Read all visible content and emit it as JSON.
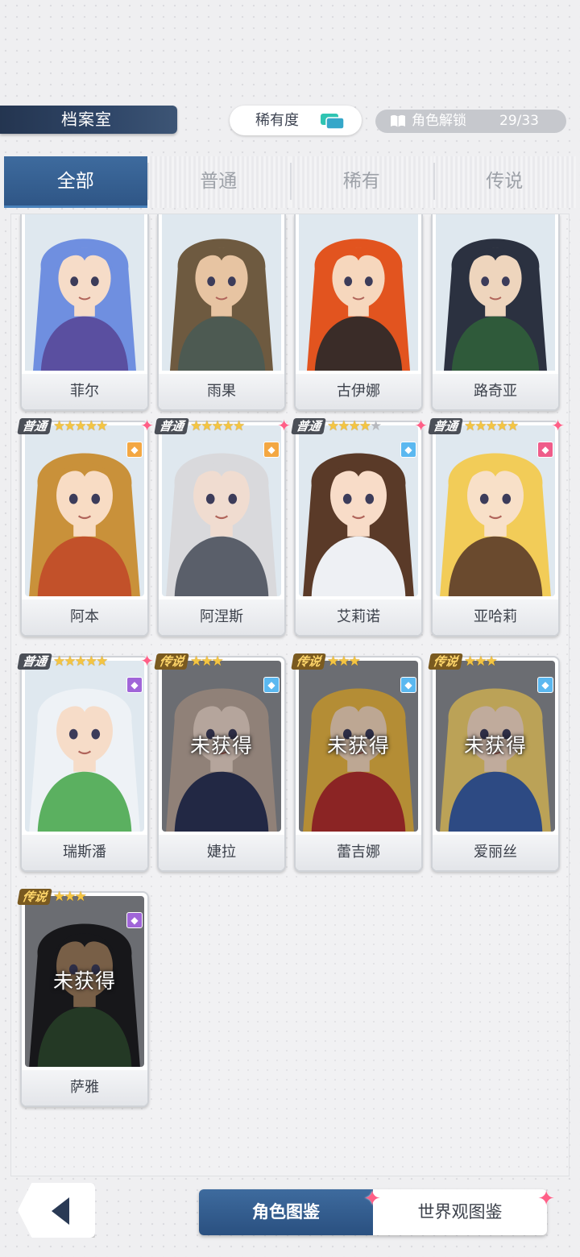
{
  "header": {
    "title": "档案室",
    "rarity_label": "稀有度",
    "unlock_label": "角色解锁",
    "unlock_count": "29/33",
    "unlock_progress": 0.879
  },
  "tabs": [
    {
      "label": "全部",
      "active": true
    },
    {
      "label": "普通",
      "active": false
    },
    {
      "label": "稀有",
      "active": false
    },
    {
      "label": "传说",
      "active": false
    }
  ],
  "locked_text": "未获得",
  "rank_labels": {
    "common": "普通",
    "legend": "传说"
  },
  "characters": [
    {
      "name": "菲尔",
      "hair": "#6f8fe0",
      "outfit": "#5a4fa0",
      "skin": "#f6dcc8"
    },
    {
      "name": "雨果",
      "hair": "#6e5a40",
      "outfit": "#4d5a52",
      "skin": "#e7c4a2"
    },
    {
      "name": "古伊娜",
      "hair": "#e2541f",
      "outfit": "#3a2c28",
      "skin": "#f6d7bd"
    },
    {
      "name": "路奇亚",
      "hair": "#2b3140",
      "outfit": "#2f5a3a",
      "skin": "#eed5bd"
    },
    {
      "name": "阿本",
      "hair": "#c9913a",
      "outfit": "#c2512a",
      "skin": "#f8dcc4",
      "rank": "common",
      "stars": 5,
      "stars_on": 5,
      "element": "orange",
      "spark": true
    },
    {
      "name": "阿涅斯",
      "hair": "#d9d9dc",
      "outfit": "#5a5f6a",
      "skin": "#f0dcd0",
      "rank": "common",
      "stars": 5,
      "stars_on": 5,
      "element": "orange",
      "spark": true
    },
    {
      "name": "艾莉诺",
      "hair": "#5a3a28",
      "outfit": "#eef0f4",
      "skin": "#f8dcc8",
      "rank": "common",
      "stars": 5,
      "stars_on": 4,
      "element": "blue",
      "spark": true
    },
    {
      "name": "亚哈莉",
      "hair": "#f2cc58",
      "outfit": "#6a4a2e",
      "skin": "#f8e0c8",
      "rank": "common",
      "stars": 5,
      "stars_on": 5,
      "element": "pink",
      "spark": true
    },
    {
      "name": "瑞斯潘",
      "hair": "#eef2f6",
      "outfit": "#5bb060",
      "skin": "#f6dcc8",
      "rank": "common",
      "stars": 5,
      "stars_on": 5,
      "element": "purple",
      "spark": true
    },
    {
      "name": "婕拉",
      "hair": "#b9a69a",
      "outfit": "#2c3458",
      "skin": "#e8d4c8",
      "rank": "legend",
      "stars": 3,
      "stars_on": 3,
      "element": "blue",
      "locked": true
    },
    {
      "name": "蕾吉娜",
      "hair": "#e7b544",
      "outfit": "#b22f2f",
      "skin": "#f2d7bd",
      "rank": "legend",
      "stars": 3,
      "stars_on": 3,
      "element": "blue",
      "locked": true
    },
    {
      "name": "爱丽丝",
      "hair": "#f0d070",
      "outfit": "#3a5fa8",
      "skin": "#f6dcc8",
      "rank": "legend",
      "stars": 3,
      "stars_on": 3,
      "element": "blue",
      "locked": true
    },
    {
      "name": "萨雅",
      "hair": "#1e1e22",
      "outfit": "#2f4a30",
      "skin": "#9a7a5c",
      "rank": "legend",
      "stars": 3,
      "stars_on": 3,
      "element": "purple",
      "locked": true
    }
  ],
  "element_colors": {
    "orange": "#f3a742",
    "blue": "#5bb8f0",
    "pink": "#ef5c8a",
    "purple": "#a065d8"
  },
  "bottom_tabs": [
    {
      "label": "角色图鉴",
      "active": true
    },
    {
      "label": "世界观图鉴",
      "active": false
    }
  ],
  "icons": {
    "sort": "sort-cards-icon",
    "book": "book-icon",
    "back": "back-arrow-icon",
    "spark": "sparkle-icon"
  }
}
